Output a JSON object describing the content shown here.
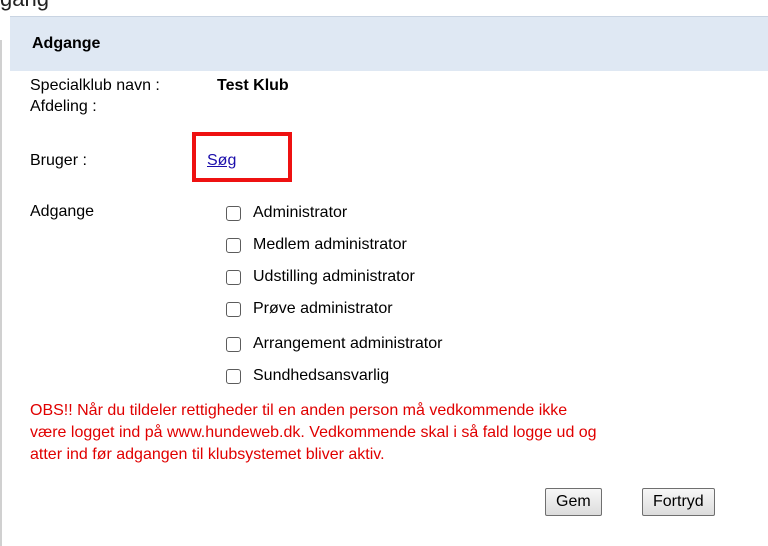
{
  "window_title_partial": "gang",
  "panel": {
    "title": "Adgange"
  },
  "fields": {
    "club_label": "Specialklub navn :",
    "club_value": "Test Klub",
    "department_label": "Afdeling :",
    "user_label": "Bruger :",
    "search_link": "Søg",
    "access_label": "Adgange"
  },
  "access_options": [
    {
      "label": "Administrator",
      "checked": false
    },
    {
      "label": "Medlem administrator",
      "checked": false
    },
    {
      "label": "Udstilling administrator",
      "checked": false
    },
    {
      "label": "Prøve administrator",
      "checked": false
    },
    {
      "label": "Arrangement administrator",
      "checked": false
    },
    {
      "label": "Sundhedsansvarlig",
      "checked": false
    }
  ],
  "notice": {
    "line1": "OBS!! Når du tildeler rettigheder til en anden person må vedkommende ikke",
    "line2": "være logget ind på www.hundeweb.dk. Vedkommende skal i så fald logge ud og",
    "line3": "atter ind før adgangen til klubsystemet bliver aktiv."
  },
  "buttons": {
    "save": "Gem",
    "cancel": "Fortryd"
  },
  "colors": {
    "header_bg": "#dfe8f3",
    "notice": "#e00000",
    "highlight": "#ee1111",
    "link": "#1a0dab"
  }
}
